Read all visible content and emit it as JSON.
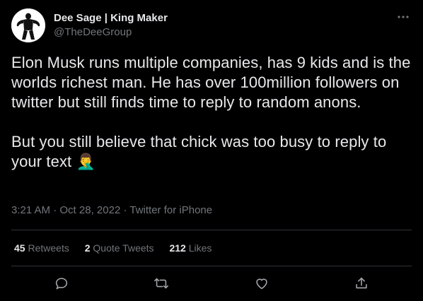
{
  "author": {
    "display_name": "Dee Sage | King Maker",
    "handle": "@TheDeeGroup",
    "avatar_icon": "muscle-man-silhouette"
  },
  "tweet": {
    "paragraph1": "Elon Musk runs multiple companies, has 9 kids and is the worlds richest man. He has over 100million followers on twitter but still finds time to reply to random anons.",
    "paragraph2": "But you still believe that chick was too busy to reply to your text 🤦‍♂️",
    "time": "3:21 AM",
    "date": "Oct 28, 2022",
    "source": "Twitter for iPhone"
  },
  "stats": {
    "retweets_count": "45",
    "retweets_label": "Retweets",
    "quotes_count": "2",
    "quotes_label": "Quote Tweets",
    "likes_count": "212",
    "likes_label": "Likes"
  },
  "meta_separator": "·",
  "icons": [
    "more-icon",
    "reply-icon",
    "retweet-icon",
    "like-icon",
    "share-icon"
  ],
  "colors": {
    "background": "#000000",
    "text_primary": "#e7e9ea",
    "text_secondary": "#71767b",
    "divider": "#2f3336"
  }
}
